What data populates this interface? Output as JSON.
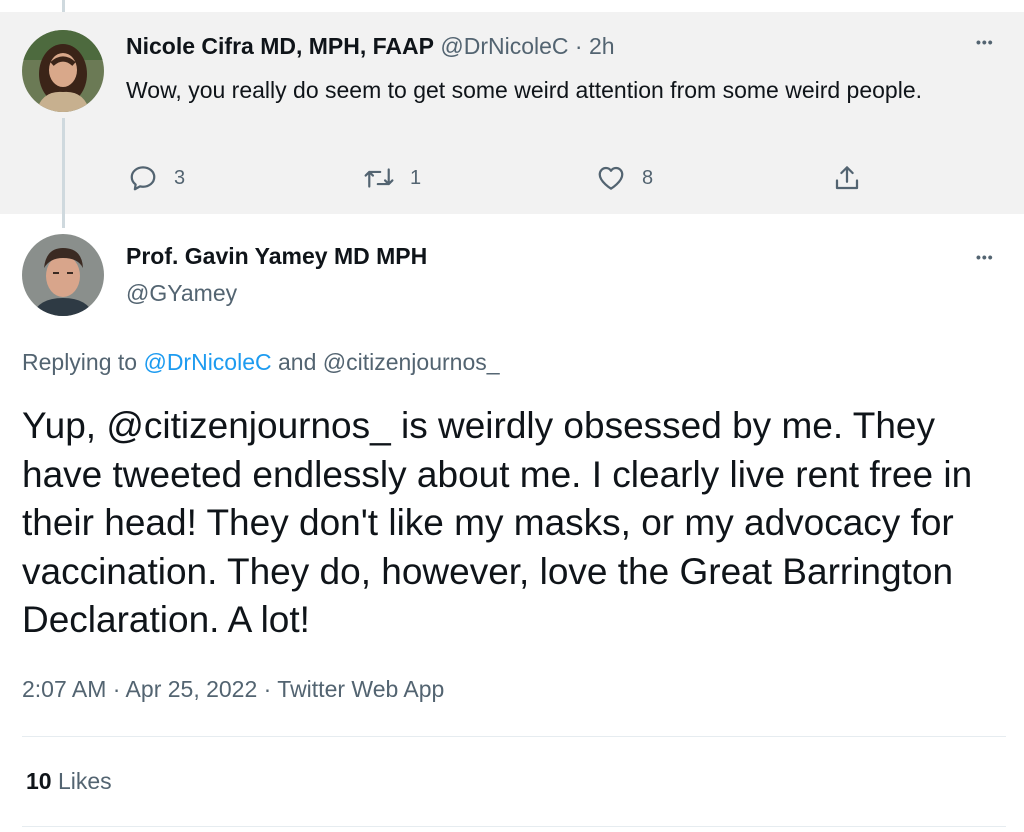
{
  "parent_tweet": {
    "author_name": "Nicole Cifra MD, MPH, FAAP",
    "handle": "@DrNicoleC",
    "separator": "·",
    "time": "2h",
    "text": "Wow, you really do seem to get some weird attention from some weird people.",
    "more": "•••",
    "actions": {
      "replies": "3",
      "retweets": "1",
      "likes": "8"
    }
  },
  "main_tweet": {
    "author_name": "Prof. Gavin Yamey MD MPH",
    "handle": "@GYamey",
    "more": "•••",
    "replying_prefix": "Replying to ",
    "replying_link": "@DrNicoleC",
    "replying_and": " and ",
    "replying_second": "@citizenjournos_",
    "text": "Yup, @citizenjournos_ is weirdly obsessed by me. They have tweeted endlessly about me. I clearly live rent free in their head! They don't like my masks, or my advocacy for vaccination. They do, however, love the Great Barrington Declaration. A lot!",
    "timestamp": "2:07 AM · Apr 25, 2022 · Twitter Web App",
    "likes_count": "10",
    "likes_label": "Likes"
  },
  "colors": {
    "link": "#1d9bf0",
    "muted": "#536471",
    "parent_background": "#f2f2f2"
  },
  "icons": [
    "reply-icon",
    "retweet-icon",
    "like-icon",
    "share-icon",
    "more-icon"
  ]
}
